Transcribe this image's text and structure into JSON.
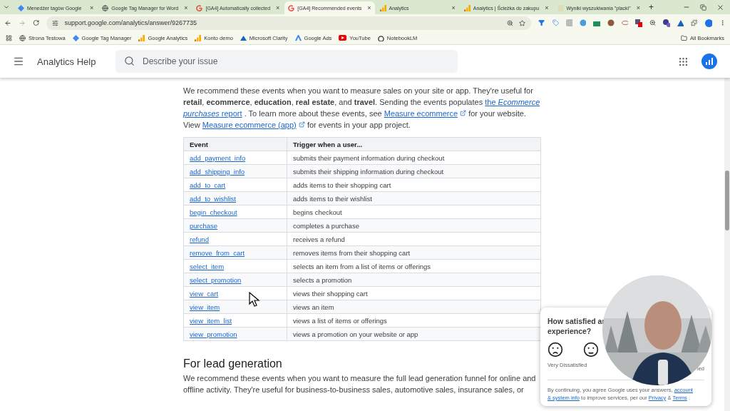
{
  "browser": {
    "tabs": [
      {
        "title": "Menedżer tagów Google",
        "selected": false
      },
      {
        "title": "Google Tag Manager for Word",
        "selected": false
      },
      {
        "title": "[GA4] Automatically collected",
        "selected": false
      },
      {
        "title": "[GA4] Recommended events",
        "selected": true
      },
      {
        "title": "Analytics",
        "selected": false
      },
      {
        "title": "Analytics | Ścieżka do zakupu",
        "selected": false
      },
      {
        "title": "Wyniki wyszukiwania \"placki\"",
        "selected": false
      }
    ],
    "close_glyph": "×",
    "new_tab": "+",
    "url": "support.google.com/analytics/answer/9267735",
    "bookmarks": [
      "Strona Testowa",
      "Google Tag Manager",
      "Google Analytics",
      "Konto demo",
      "Microsoft Clarity",
      "Google Ads",
      "YouTube",
      "NotebookLM"
    ],
    "all_bookmarks": "All Bookmarks"
  },
  "header": {
    "title": "Analytics Help",
    "search": {
      "placeholder": "Describe your issue"
    }
  },
  "online_sales": {
    "paragraph": [
      {
        "kind": "text",
        "text": "We recommend these events when you want to measure sales on your site or app. They're useful for **retail**, **ecommerce**, **education**, **real estate**, and **travel**. Sending the events populates"
      },
      {
        "kind": "link",
        "text": "the *Ecommerce*"
      },
      {
        "kind": "link",
        "text": "*purchases* report"
      },
      {
        "kind": "text",
        "text": ". To learn more about these events, see"
      },
      {
        "kind": "link",
        "text": "Measure ecommerce",
        "external": true
      },
      {
        "kind": "text",
        "text": "for your website. View"
      },
      {
        "kind": "link",
        "text": "Measure ecommerce (app)",
        "external": true
      },
      {
        "kind": "text",
        "text": "for events in your app project."
      }
    ],
    "table": {
      "columns": [
        "Event",
        "Trigger when a user..."
      ],
      "rows": [
        [
          "add_payment_info",
          "submits their payment information during checkout"
        ],
        [
          "add_shipping_info",
          "submits their shipping information during checkout"
        ],
        [
          "add_to_cart",
          "adds items to their shopping cart"
        ],
        [
          "add_to_wishlist",
          "adds items to their wishlist"
        ],
        [
          "begin_checkout",
          "begins checkout"
        ],
        [
          "purchase",
          "completes a purchase"
        ],
        [
          "refund",
          "receives a refund"
        ],
        [
          "remove_from_cart",
          "removes items from their shopping cart"
        ],
        [
          "select_item",
          "selects an item from a list of items or offerings"
        ],
        [
          "select_promotion",
          "selects a promotion"
        ],
        [
          "view_cart",
          "views their shopping cart"
        ],
        [
          "view_item",
          "views an item"
        ],
        [
          "view_item_list",
          "views a list of items or offerings"
        ],
        [
          "view_promotion",
          "views a promotion on your website or app"
        ]
      ]
    }
  },
  "lead_generation": {
    "heading": "For lead generation",
    "paragraph": [
      {
        "kind": "text",
        "text": "We recommend these events when you want to measure the full lead generation funnel for online and offline activity. They're useful for business-to-business sales, automotive sales, insurance sales, or"
      }
    ]
  },
  "survey": {
    "question_lines": [
      "How satisfied ar",
      "experience?"
    ],
    "rating_labels": [
      "Very Dissatisfied"
    ],
    "cut_label": "ied",
    "disclaimer": [
      {
        "kind": "text",
        "text": "By continuing, you agree Google uses your answers,"
      },
      {
        "kind": "link",
        "text": "account"
      },
      {
        "kind": "link",
        "text": "& system info"
      },
      {
        "kind": "text",
        "text": "to improve services, per our"
      },
      {
        "kind": "link",
        "text": "Privacy"
      },
      {
        "kind": "text",
        "text": "&"
      },
      {
        "kind": "link",
        "text": "Terms"
      },
      {
        "kind": "text",
        "text": "."
      }
    ]
  }
}
